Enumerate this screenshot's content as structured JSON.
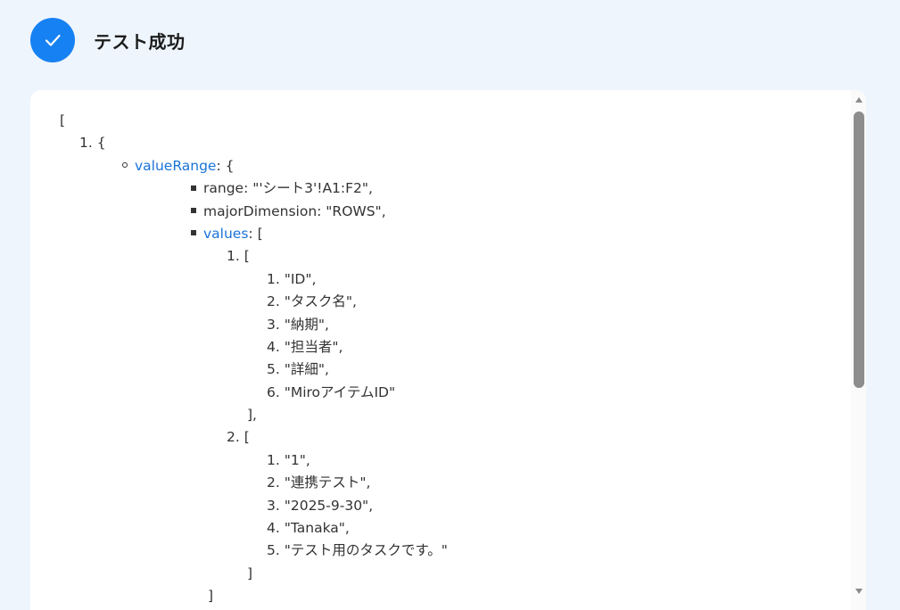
{
  "header": {
    "title": "テスト成功",
    "icon": "check-icon",
    "accent_color": "#1681f2"
  },
  "json_output": {
    "open_bracket": "[",
    "item1_open": "1. {",
    "value_range_key": "valueRange",
    "value_range_suffix": ": {",
    "range_line": "range: \"'シート3'!A1:F2\",",
    "major_dimension_line": "majorDimension: \"ROWS\",",
    "values_key": "values",
    "values_suffix": ": [",
    "row1_open": "1. [",
    "row1_cells": [
      "1. \"ID\",",
      "2. \"タスク名\",",
      "3. \"納期\",",
      "4. \"担当者\",",
      "5. \"詳細\",",
      "6. \"MiroアイテムID\""
    ],
    "row1_close": "],",
    "row2_open": "2. [",
    "row2_cells": [
      "1. \"1\",",
      "2. \"連携テスト\",",
      "3. \"2025-9-30\",",
      "4. \"Tanaka\",",
      "5. \"テスト用のタスクです。\""
    ],
    "row2_close": "]",
    "values_close": "]"
  }
}
